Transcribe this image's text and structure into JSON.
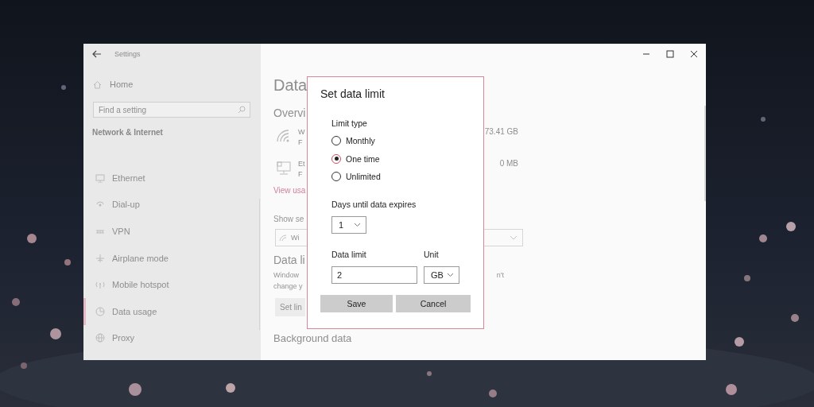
{
  "window": {
    "title": "Settings"
  },
  "sidebar": {
    "home": "Home",
    "search": {
      "placeholder": "Find a setting"
    },
    "section": "Network & Internet",
    "items": [
      {
        "label": "Ethernet",
        "selected": false
      },
      {
        "label": "Dial-up",
        "selected": false
      },
      {
        "label": "VPN",
        "selected": false
      },
      {
        "label": "Airplane mode",
        "selected": false
      },
      {
        "label": "Mobile hotspot",
        "selected": false
      },
      {
        "label": "Data usage",
        "selected": true
      },
      {
        "label": "Proxy",
        "selected": false
      }
    ]
  },
  "main": {
    "heading": "Data",
    "overview": "Overvi",
    "networks": [
      {
        "kind": "wifi",
        "name": "W",
        "detail": "F",
        "usage": "73.41 GB"
      },
      {
        "kind": "ethernet",
        "name": "Et",
        "detail": "F",
        "usage": "0 MB"
      }
    ],
    "view_link": "View usa",
    "show_label": "Show se",
    "network_dropdown": {
      "value": "Wi"
    },
    "limit_heading": "Data li",
    "limit_text": "Window",
    "limit_text_end": "n't",
    "limit_text_2": "change y",
    "set_limit_button": "Set lin",
    "background_heading": "Background data"
  },
  "dialog": {
    "title": "Set data limit",
    "limit_type_label": "Limit type",
    "limit_types": [
      {
        "label": "Monthly",
        "selected": false
      },
      {
        "label": "One time",
        "selected": true
      },
      {
        "label": "Unlimited",
        "selected": false
      }
    ],
    "days_label": "Days until data expires",
    "days": {
      "value": "1"
    },
    "data_limit_label": "Data limit",
    "data_limit": {
      "value": "2"
    },
    "unit_label": "Unit",
    "unit": {
      "value": "GB"
    },
    "buttons": [
      "Save",
      "Cancel"
    ]
  }
}
